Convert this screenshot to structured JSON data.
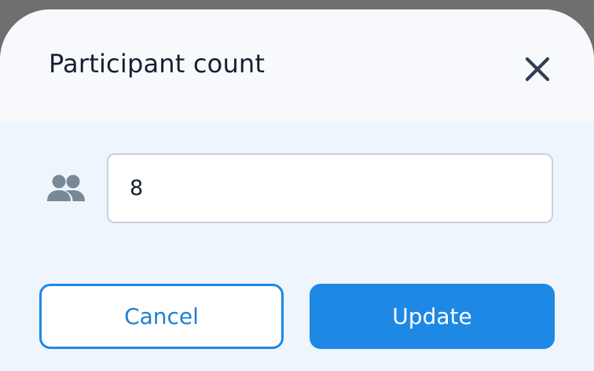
{
  "dialog": {
    "title": "Participant count",
    "close_icon": "close-icon"
  },
  "participants": {
    "icon": "people-icon",
    "value": "8"
  },
  "actions": {
    "cancel_label": "Cancel",
    "update_label": "Update"
  },
  "colors": {
    "accent": "#1E88E5",
    "title_text": "#162032",
    "icon_gray": "#7A8796",
    "field_border": "#C7D1DC",
    "body_background": "#EEF5FD"
  }
}
